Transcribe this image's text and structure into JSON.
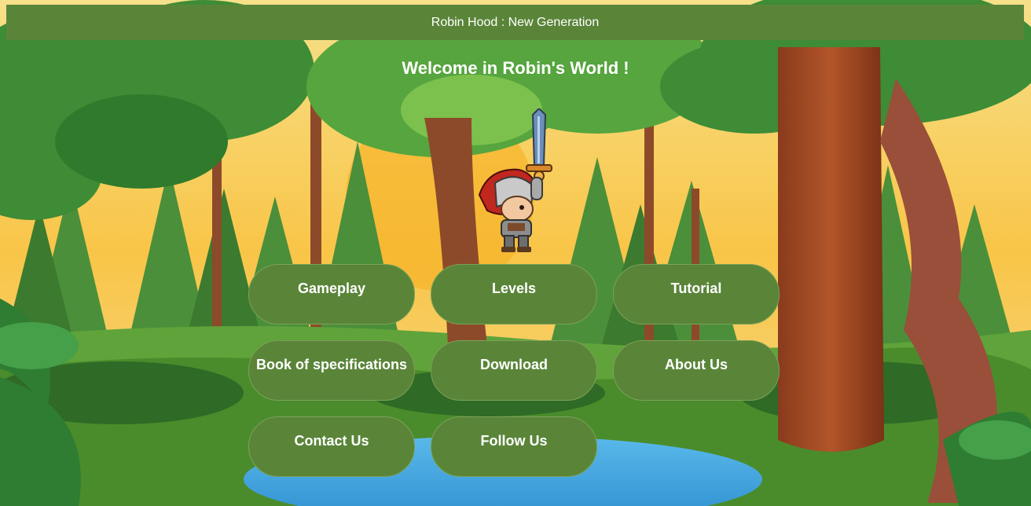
{
  "header": {
    "title": "Robin Hood : New Generation"
  },
  "welcome": {
    "heading": "Welcome in Robin's World !"
  },
  "menu": {
    "items": [
      {
        "label": "Gameplay"
      },
      {
        "label": "Levels"
      },
      {
        "label": "Tutorial"
      },
      {
        "label": "Book of specifications"
      },
      {
        "label": "Download"
      },
      {
        "label": "About Us"
      },
      {
        "label": "Contact Us"
      },
      {
        "label": "Follow Us"
      }
    ]
  },
  "colors": {
    "button_bg": "#5a8539",
    "header_bg": "#5a8539",
    "text": "#ffffff"
  }
}
